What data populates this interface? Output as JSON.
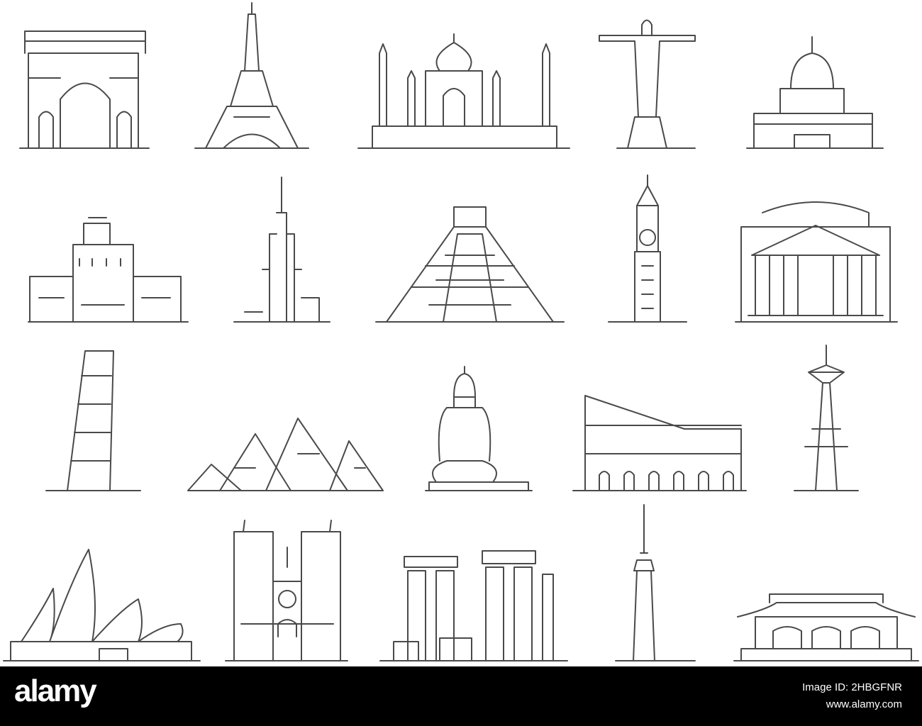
{
  "watermark": {
    "logo": "alamy",
    "image_id": "Image ID: 2HBGFNR",
    "url": "www.alamy.com"
  },
  "colors": {
    "line": "#4a4a4a",
    "bar": "#000000",
    "bar_text": "#ffffff"
  }
}
